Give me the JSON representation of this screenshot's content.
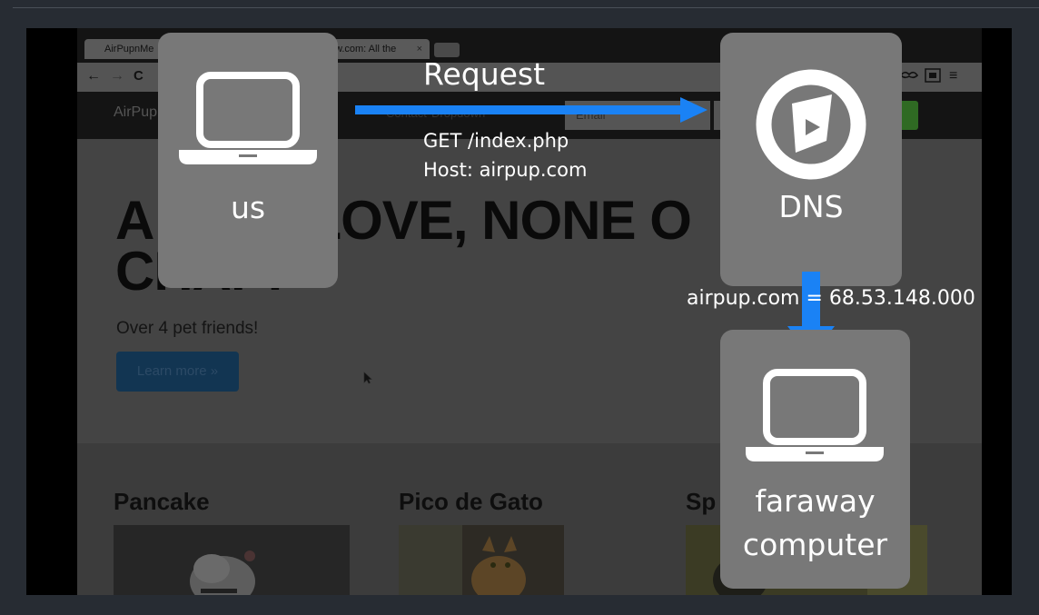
{
  "diagram": {
    "us_label": "us",
    "dns_label": "DNS",
    "faraway_line1": "faraway",
    "faraway_line2": "computer",
    "request_title": "Request",
    "request_line1": "GET /index.php",
    "request_line2": "Host: airpup.com",
    "dns_result": "airpup.com = 68.53.148.000",
    "arrow_color": "#1a82f5",
    "box_color": "#787878"
  },
  "background_page": {
    "tabs": [
      {
        "label": "AirPupnMe"
      },
      {
        "label": "w.com: All the"
      }
    ],
    "tab_close": "×",
    "nav_back": "←",
    "nav_forward": "→",
    "nav_reload": "C",
    "toolbar_icons": [
      "mustache-icon",
      "zh-extension-icon",
      "menu-icon"
    ],
    "toolbar_menu": "≡",
    "navbar": {
      "brand": "AirPup",
      "links": [
        "Contact",
        "Dropdown"
      ],
      "email_placeholder": "Email"
    },
    "hero": {
      "title_line1": "A           LOVE, NONE O",
      "title_line2": "CHAP!",
      "subtitle": "Over 4 pet friends!",
      "button": "Learn more »"
    },
    "cards": [
      {
        "title": "Pancake"
      },
      {
        "title": "Pico de Gato"
      },
      {
        "title": "Sp"
      }
    ]
  }
}
